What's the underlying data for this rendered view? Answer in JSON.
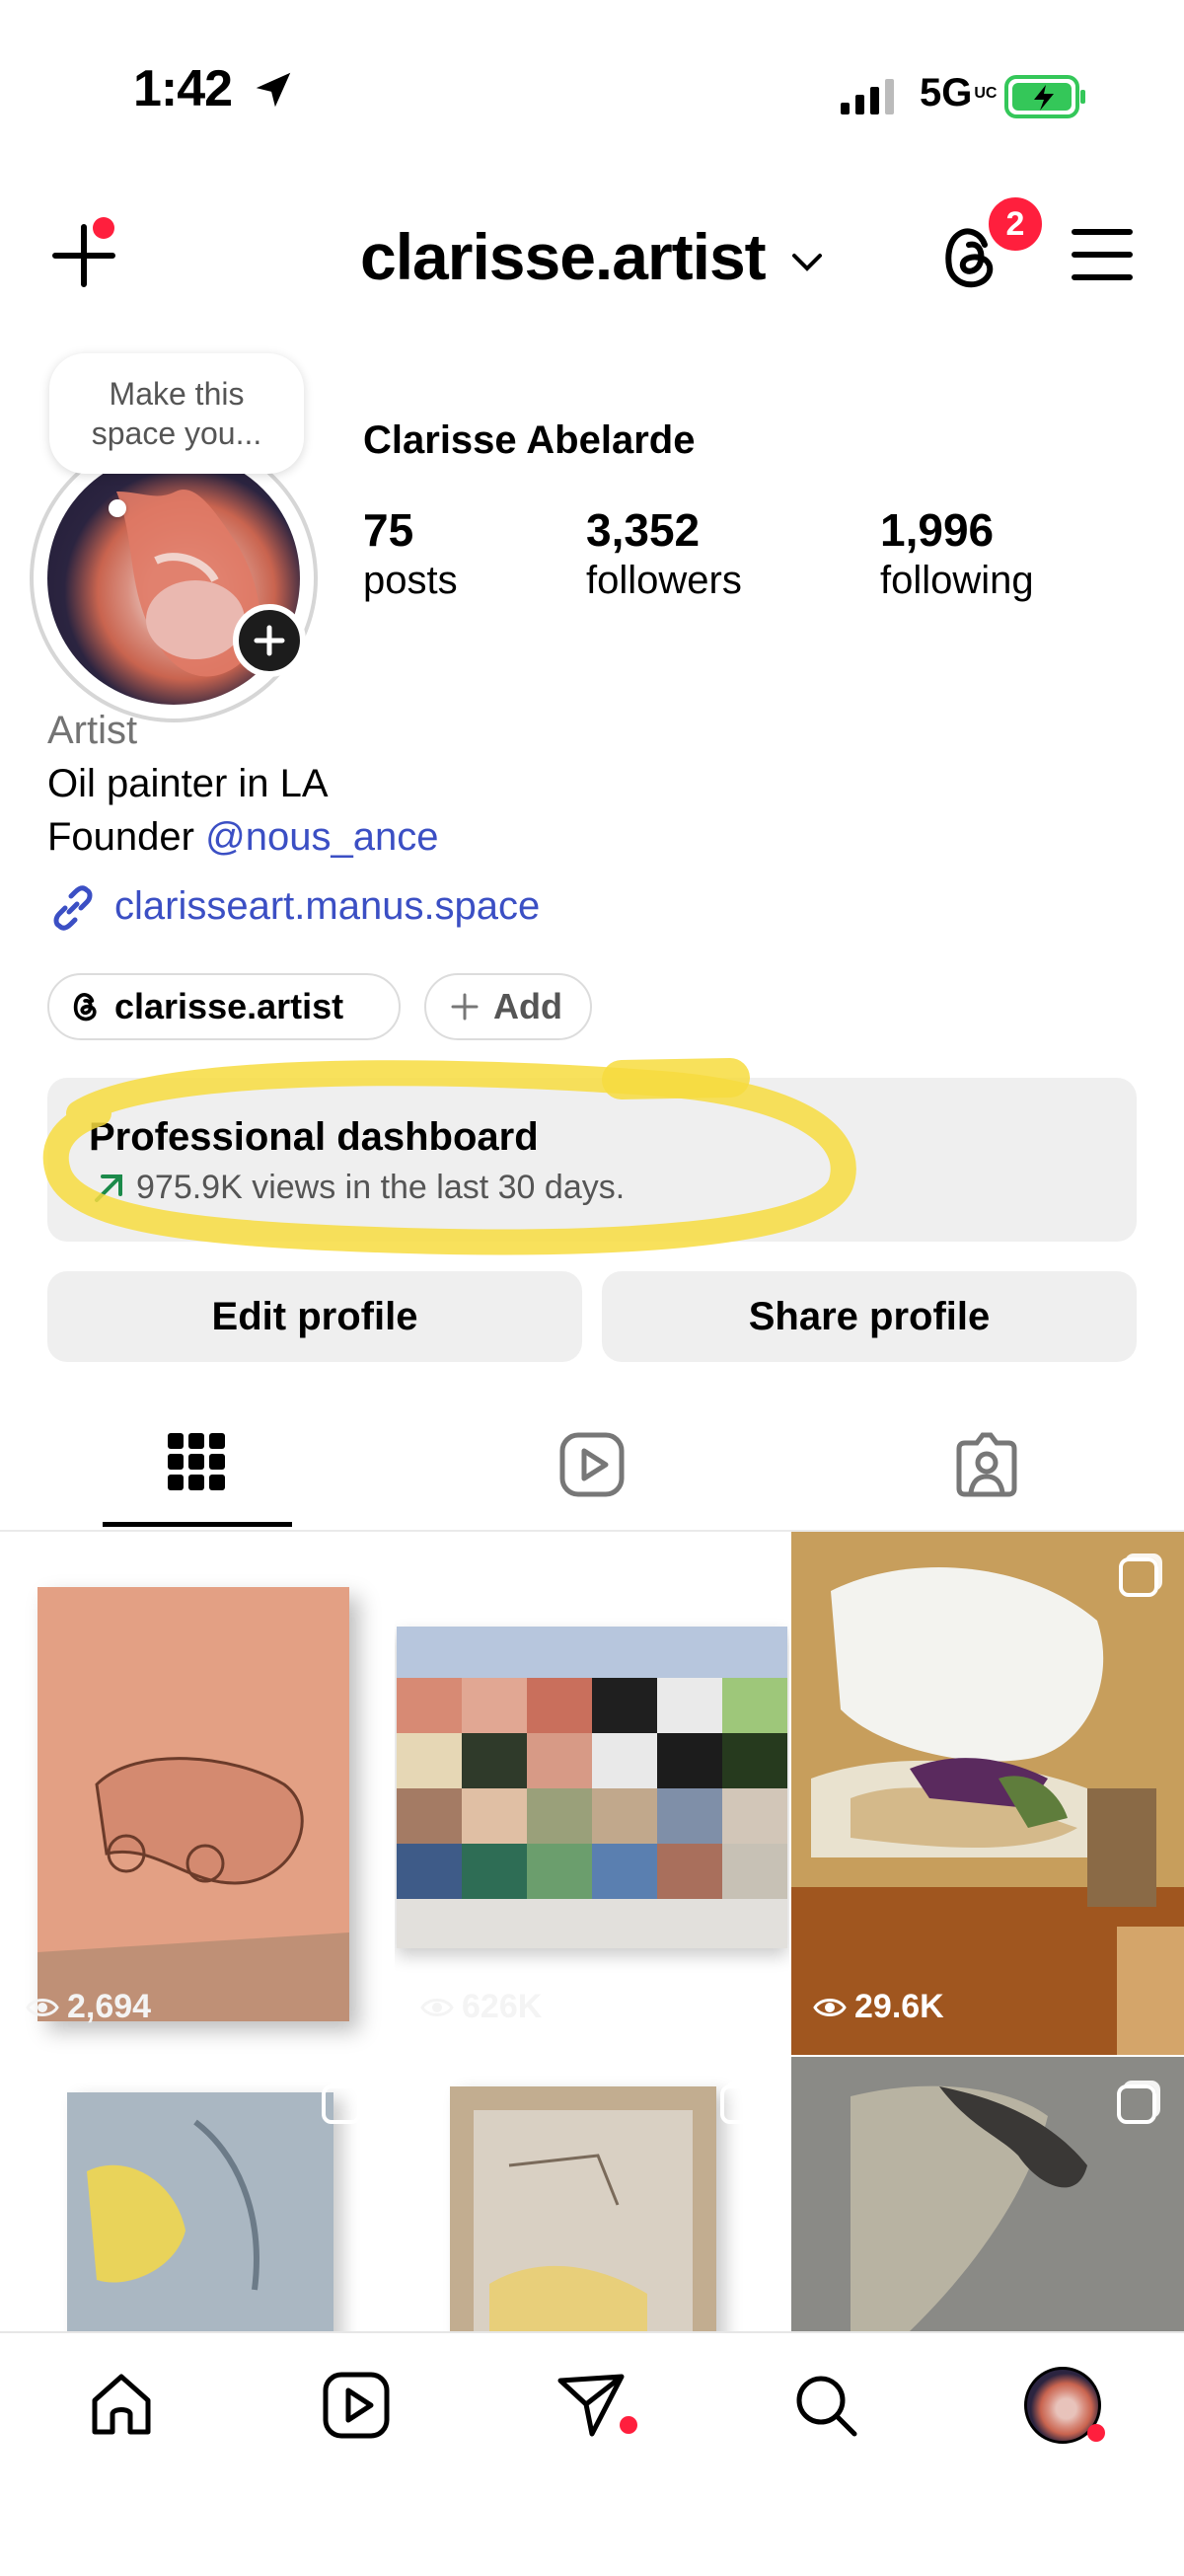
{
  "status_bar": {
    "time": "1:42",
    "network": "5G",
    "network_suffix": "UC"
  },
  "header": {
    "username": "clarisse.artist",
    "threads_badge": "2"
  },
  "profile": {
    "note_line1": "Make this",
    "note_line2": "space you...",
    "full_name": "Clarisse Abelarde",
    "stats": [
      {
        "value": "75",
        "label": "posts"
      },
      {
        "value": "3,352",
        "label": "followers"
      },
      {
        "value": "1,996",
        "label": "following"
      }
    ],
    "category": "Artist",
    "bio_line1": "Oil painter in LA",
    "bio_line2_prefix": "Founder",
    "bio_mention": "@nous_ance",
    "link": "clarisseart.manus.space"
  },
  "chips": {
    "threads_label": "clarisse.artist",
    "add_label": "Add"
  },
  "dashboard": {
    "title": "Professional dashboard",
    "subtitle": "975.9K views in the last 30 days."
  },
  "buttons": {
    "edit": "Edit profile",
    "share": "Share profile"
  },
  "grid": [
    {
      "views": "2,694"
    },
    {
      "views": "626K"
    },
    {
      "views": "29.6K"
    },
    {
      "views": ""
    },
    {
      "views": ""
    },
    {
      "views": ""
    }
  ],
  "colors": {
    "accent_link": "#3b4fc4",
    "badge": "#ff1f3d",
    "highlight": "#f7dc3f",
    "battery": "#34c759"
  },
  "icons": [
    "location-arrow-icon",
    "signal-icon",
    "battery-icon",
    "create-plus-icon",
    "chevron-down-icon",
    "threads-icon",
    "menu-icon",
    "link-icon",
    "trend-up-icon",
    "grid-icon",
    "reels-icon",
    "tagged-icon",
    "home-icon",
    "reels-nav-icon",
    "messages-icon",
    "search-icon",
    "profile-avatar-icon"
  ]
}
